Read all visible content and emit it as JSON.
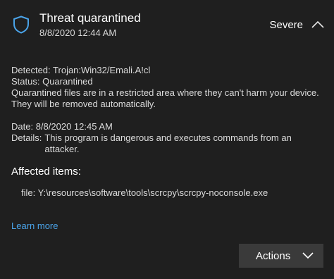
{
  "notification": {
    "title": "Threat quarantined",
    "date": "8/8/2020 12:44 AM",
    "severity": "Severe",
    "icon": "shield-icon",
    "colors": {
      "background": "#1f1f1f",
      "link": "#4aa3e8",
      "button": "#3a3a3a",
      "shield": "#4aa3e8"
    }
  },
  "details": {
    "detected_label": "Detected:",
    "detected_value": "Trojan:Win32/Emali.A!cl",
    "status_label": "Status:",
    "status_value": "Quarantined",
    "status_desc_1": "Quarantined files are in a restricted area where they can't harm your device.",
    "status_desc_2": "They will be removed automatically.",
    "date_label": "Date:",
    "date_value": "8/8/2020 12:45 AM",
    "details_label": "Details:",
    "details_value": "This program is dangerous and executes commands from an attacker."
  },
  "affected": {
    "heading": "Affected items:",
    "file": "file: Y:\\resources\\software\\tools\\scrcpy\\scrcpy-noconsole.exe"
  },
  "links": {
    "learn_more": "Learn more"
  },
  "actions": {
    "label": "Actions"
  }
}
